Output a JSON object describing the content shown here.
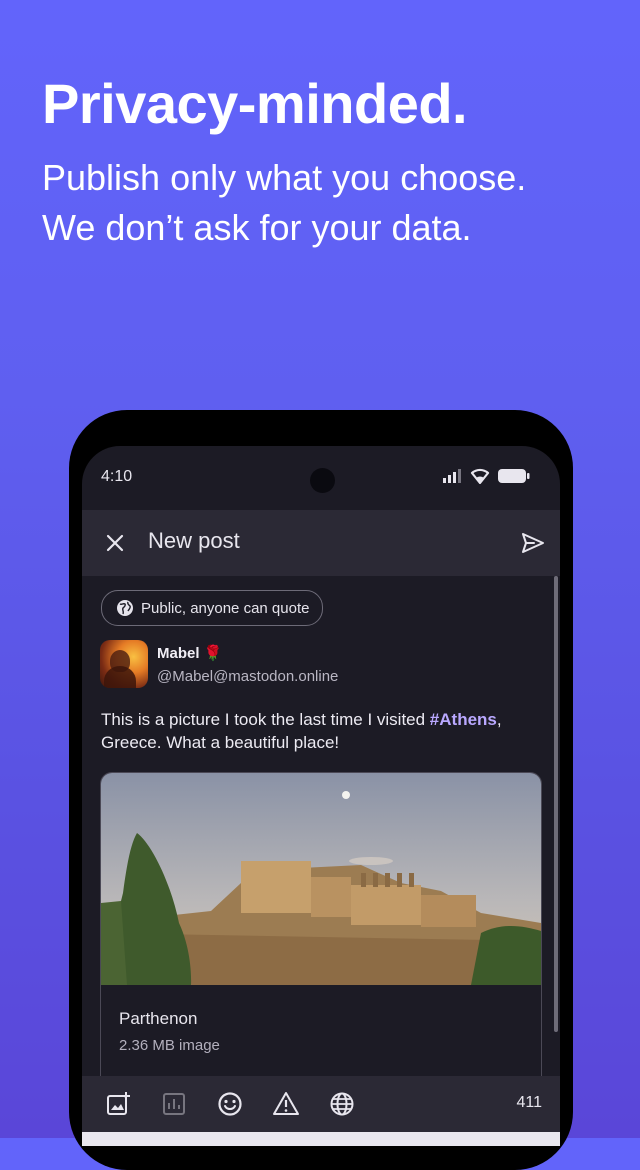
{
  "marketing": {
    "headline": "Privacy-minded.",
    "sub_line_1": "Publish only what you choose.",
    "sub_line_2": "We don’t ask for your data."
  },
  "status_bar": {
    "time": "4:10",
    "icons": [
      "signal-icon",
      "wifi-icon",
      "battery-icon"
    ]
  },
  "top_bar": {
    "close_icon": "close-icon",
    "title": "New post",
    "send_icon": "send-icon"
  },
  "composer": {
    "visibility_label": "Public, anyone can quote",
    "visibility_icon": "globe-icon",
    "author": {
      "name": "Mabel",
      "emoji": "🌹",
      "handle": "@Mabel@mastodon.online"
    },
    "text_before": "This is a picture I took the last time I visited ",
    "hashtag": "#Athens",
    "text_after": ", Greece. What a beautiful place!",
    "attachment": {
      "title": "Parthenon",
      "subtitle": "2.36 MB image"
    }
  },
  "toolbar": {
    "tools": [
      "add-media-icon",
      "poll-icon",
      "emoji-icon",
      "content-warning-icon",
      "language-globe-icon"
    ],
    "char_count": "411"
  },
  "colors": {
    "accent": "#b9a8ff",
    "background_top": "#6264fb",
    "background_bottom": "#5a46d8",
    "screen": "#1c1b25",
    "bar": "#2b2935"
  }
}
